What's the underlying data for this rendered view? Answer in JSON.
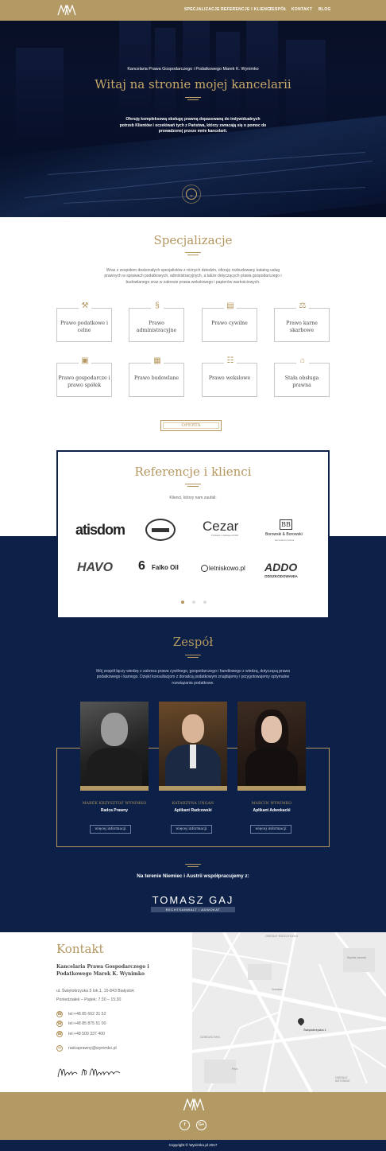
{
  "nav": {
    "items": [
      "SPECJALIZACJE",
      "REFERENCJE I KLIENCI",
      "ZESPÓŁ",
      "KONTAKT",
      "BLOG"
    ]
  },
  "hero": {
    "subtitle": "Kancelaria Prawa Gospodarczego i Podatkowego Marek K. Wynimko",
    "title": "Witaj na stronie mojej kancelarii",
    "text": "Oferuję kompleksową obsługę prawną dopasowaną do indywidualnych potrzeb Klientów i oczekiwań tych z Państwa, którzy zwracają się o pomoc do prowadzonej przeze mnie kancelarii."
  },
  "spec": {
    "title": "Specjalizacje",
    "text": "Wraz z zespołem doskonałych specjalistów z różnych dziedzin, oferuję rozbudowany katalog usług prawnych w sprawach podatkowych, administracyjnych, a także dotyczących prawa gospodarczego i budowlanego oraz w zakresie prawa wekslowego i papierów wartościowych.",
    "cards": [
      {
        "label": "Prawo podatkowe i celne",
        "icon": "tools-icon"
      },
      {
        "label": "Prawo administracyjne",
        "icon": "paragraph-icon"
      },
      {
        "label": "Prawo cywilne",
        "icon": "register-icon"
      },
      {
        "label": "Prawo karne skarbowe",
        "icon": "scales-icon"
      },
      {
        "label": "Prawo gospodarcze i prawo spółek",
        "icon": "presentation-icon"
      },
      {
        "label": "Prawo budowlane",
        "icon": "buildings-icon"
      },
      {
        "label": "Prawo wekslowe",
        "icon": "document-icon"
      },
      {
        "label": "Stała obsługa prawna",
        "icon": "institution-icon"
      }
    ],
    "button": "OFERTA"
  },
  "ref": {
    "title": "Referencje i klienci",
    "subtitle": "Klienci, którzy nam zaufali:",
    "logos": [
      "atisdom",
      "Cezar",
      "Borowski & Borowski",
      "HAVO",
      "Falko Oil",
      "letniskowo.pl",
      "ADDO",
      "ODSZKODOWANIA"
    ],
    "logo_sub": {
      "cezar": "Konfekcja z nadzieją od 1993",
      "borowski": "kancelaria prawna"
    }
  },
  "team": {
    "title": "Zespół",
    "text": "Mój zespół łączy wiedzę z zakresu prawa cywilnego, gospodarczego i handlowego z wiedzą, dotyczącą prawa podatkowego i karnego. Dzięki konsultacjom z doradcą podatkowym znajdujemy i przygotowujemy optymalne rozwiązania podatkowe.",
    "members": [
      {
        "name": "MAREK KRZYSZTOF WYNIMKO",
        "role": "Radca Prawny",
        "button": "więcej informacji"
      },
      {
        "name": "KATARZYNA UNGAN",
        "role": "Aplikant Radcowski",
        "button": "więcej informacji"
      },
      {
        "name": "MARCIN WYNIMKO",
        "role": "Aplikant Adwokacki",
        "button": "więcej informacji"
      }
    ],
    "partner_text": "Na terenie Niemiec i Austrii współpracujemy z:",
    "partner_name": "TOMASZ GAJ",
    "partner_sub": "RECHTSANWALT / ADWOKAT"
  },
  "contact": {
    "title": "Kontakt",
    "company": "Kancelaria Prawa Gospodarczego i Podatkowego Marek K. Wynimko",
    "address": "ul. Świętokrzyska 5 lok.1, 15-843 Białystok",
    "hours": "Poniedziałek – Piątek: 7:30 – 15:30",
    "phones": [
      "tel:+48 85 662 31 52",
      "tel:+48 85 875 51 00",
      "tel:+48 509 337 400"
    ],
    "email": "radcaprawny@wynimko.pl",
    "signature": "Marek K. Wynimko",
    "map_labels": [
      "Świętokrzyska 1",
      "OSIEDLE ANTONIUK",
      "Park",
      "DZIEDZICTWO",
      "OSIEDLE RZECZYCKA II",
      "Wydział Lekarski",
      "Cmentarz"
    ]
  },
  "footer": {
    "copyright": "Copyright © Wynimko.pl 2017",
    "social": [
      "f",
      "G+"
    ]
  },
  "colors": {
    "gold": "#b39a64",
    "navy": "#0d2148"
  }
}
